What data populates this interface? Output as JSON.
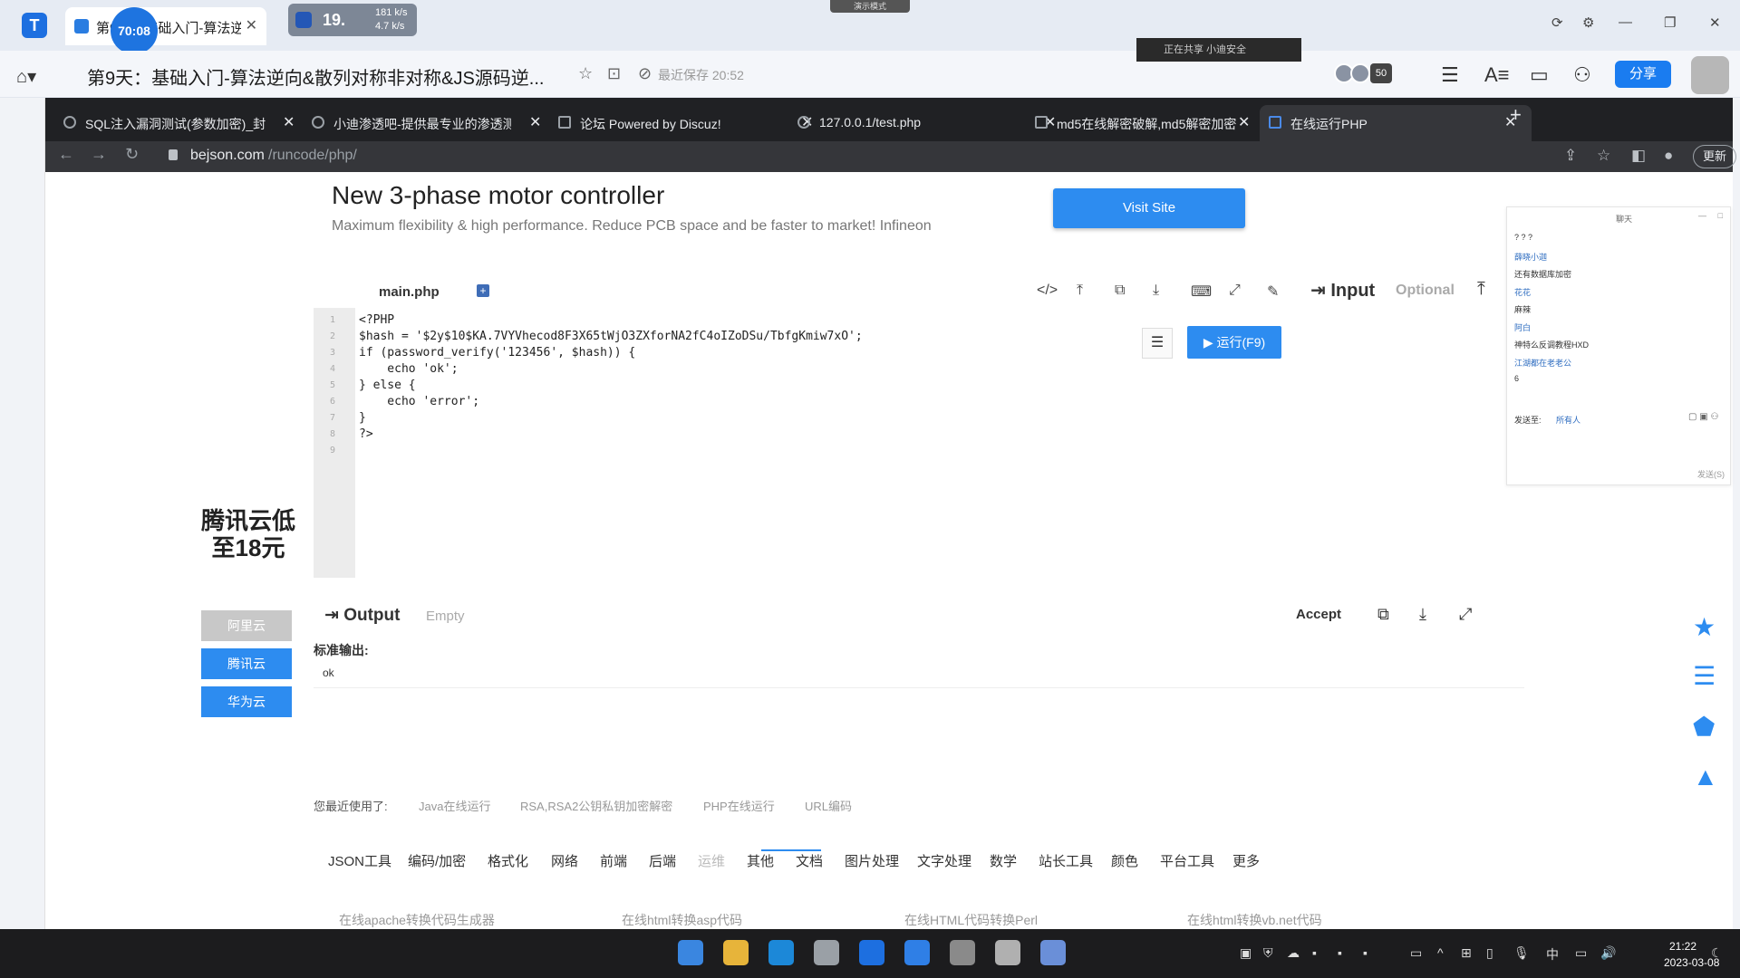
{
  "host": {
    "tab_label": "第9天：基础入门-算法逆…",
    "timer": "70:08",
    "speed_temp": "19.",
    "speed_up": "181 k/s",
    "speed_down": "4.7 k/s",
    "sharing_pill": "演示模式",
    "doc_title": "第9天：基础入门-算法逆向&散列对称非对称&JS源码逆...",
    "saved_text": "最近保存 20:52",
    "notify_text": "正在共享 小迪安全",
    "avatar_count": "50",
    "share_label": "分享"
  },
  "chrome": {
    "tabs": [
      {
        "label": "SQL注入漏洞测试(参数加密)_封"
      },
      {
        "label": "小迪渗透吧-提供最专业的渗透测"
      },
      {
        "label": "论坛    Powered by Discuz!"
      },
      {
        "label": "127.0.0.1/test.php"
      },
      {
        "label": "md5在线解密破解,md5解密加密"
      },
      {
        "label": "在线运行PHP"
      }
    ],
    "url_host": "bejson.com",
    "url_path": "/runcode/php/",
    "update_label": "更新"
  },
  "ad": {
    "title": "New 3-phase motor controller",
    "subtitle": "Maximum flexibility & high performance. Reduce PCB space and be faster to market! Infineon",
    "visit_label": "Visit Site"
  },
  "editor": {
    "file_name": "main.php",
    "input_label": "Input",
    "optional_label": "Optional",
    "run_label": "运行(F9)",
    "code": [
      {
        "num": "1",
        "text": "<?PHP"
      },
      {
        "num": "2",
        "text": "$hash = '$2y$10$KA.7VYVhecod8F3X65tWjO3ZXforNA2fC4oIZoDSu/TbfgKmiw7xO';"
      },
      {
        "num": "3",
        "text": "if (password_verify('123456', $hash)) {"
      },
      {
        "num": "4",
        "text": "    echo 'ok';"
      },
      {
        "num": "5",
        "text": "} else {"
      },
      {
        "num": "6",
        "text": "    echo 'error';"
      },
      {
        "num": "7",
        "text": "}"
      },
      {
        "num": "8",
        "text": "?>"
      },
      {
        "num": "9",
        "text": ""
      }
    ]
  },
  "chat": {
    "title": "聊天",
    "messages": [
      {
        "text": "? ? ?",
        "color": "#333333"
      },
      {
        "text": "薛晓小迦",
        "color": "#2d6cc0"
      },
      {
        "text": "还有数据库加密",
        "color": "#333333"
      },
      {
        "text": "花花",
        "color": "#2d6cc0"
      },
      {
        "text": "麻辣",
        "color": "#333333"
      },
      {
        "text": "阿白",
        "color": "#2d6cc0"
      },
      {
        "text": "神特么反调教程HXD",
        "color": "#333333"
      },
      {
        "text": "江湖都在老老公",
        "color": "#2d6cc0"
      },
      {
        "text": "6",
        "color": "#333333"
      }
    ],
    "send_to_label": "发送至:",
    "send_target": "所有人",
    "send_label": "发送(S)"
  },
  "side_ad": {
    "title": "腾讯云低至18元",
    "buttons": [
      "阿里云",
      "腾讯云",
      "华为云"
    ]
  },
  "output": {
    "label": "Output",
    "empty_label": "Empty",
    "accept_label": "Accept",
    "stdout_label": "标准输出:",
    "stdout_value": "ok"
  },
  "recent": {
    "label": "您最近使用了:",
    "links": [
      "Java在线运行",
      "RSA,RSA2公钥私钥加密解密",
      "PHP在线运行",
      "URL编码"
    ]
  },
  "categories": [
    "JSON工具",
    "编码/加密",
    "格式化",
    "网络",
    "前端",
    "后端",
    "运维",
    "其他",
    "文档",
    "图片处理",
    "文字处理",
    "数学",
    "站长工具",
    "颜色",
    "平台工具",
    "更多"
  ],
  "tool_links": [
    "在线apache转换代码生成器",
    "在线html转换asp代码",
    "在线HTML代码转换Perl",
    "在线html转换vb.net代码"
  ],
  "taskbar": {
    "apps": [
      {
        "name": "start",
        "color": "#3a86e0"
      },
      {
        "name": "explorer",
        "color": "#e7b43a"
      },
      {
        "name": "edge",
        "color": "#1c88d8"
      },
      {
        "name": "chrome",
        "color": "#9aa0a6"
      },
      {
        "name": "docs",
        "color": "#1d6fe0"
      },
      {
        "name": "meeting",
        "color": "#2f7fe6"
      },
      {
        "name": "app7",
        "color": "#8a8a8a"
      },
      {
        "name": "app8",
        "color": "#b0b0b0"
      },
      {
        "name": "app9",
        "color": "#6a8fd8"
      }
    ],
    "ime": "中",
    "time": "21:22",
    "date": "2023-03-08"
  }
}
